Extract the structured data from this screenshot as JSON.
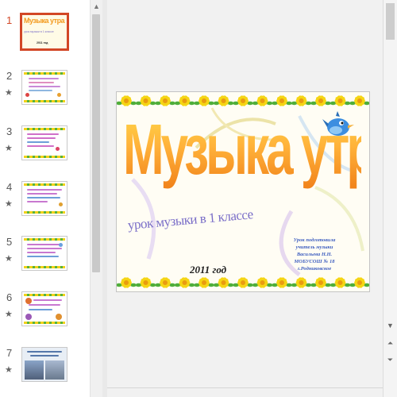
{
  "thumbnails": [
    {
      "number": "1",
      "star": "",
      "active": true
    },
    {
      "number": "2",
      "star": "★",
      "active": false
    },
    {
      "number": "3",
      "star": "★",
      "active": false
    },
    {
      "number": "4",
      "star": "★",
      "active": false
    },
    {
      "number": "5",
      "star": "★",
      "active": false
    },
    {
      "number": "6",
      "star": "★",
      "active": false
    },
    {
      "number": "7",
      "star": "★",
      "active": false
    }
  ],
  "thumb1": {
    "title": "Музыка утра",
    "subtitle": "урок музыки в 1 классе",
    "year": "2011 год"
  },
  "slide": {
    "title": "Музыка утра",
    "subtitle": "урок музыки в 1 классе",
    "year": "2011 год",
    "author_lines": [
      "Урок подготовила",
      "учитель музыки",
      "Васильева Н.Н.",
      "МОБУСОШ № 18",
      "г.Родниковское"
    ]
  },
  "scrollbars": {
    "up_icon": "scroll-up-arrow",
    "down_icon": "scroll-down-arrow",
    "prev_slide_icon": "double-up-arrow",
    "next_slide_icon": "double-down-arrow"
  },
  "colors": {
    "accent": "#d24726",
    "title_orange": "#f5a623",
    "subtitle_purple": "#7a6ec8",
    "author_blue": "#4060c0"
  }
}
